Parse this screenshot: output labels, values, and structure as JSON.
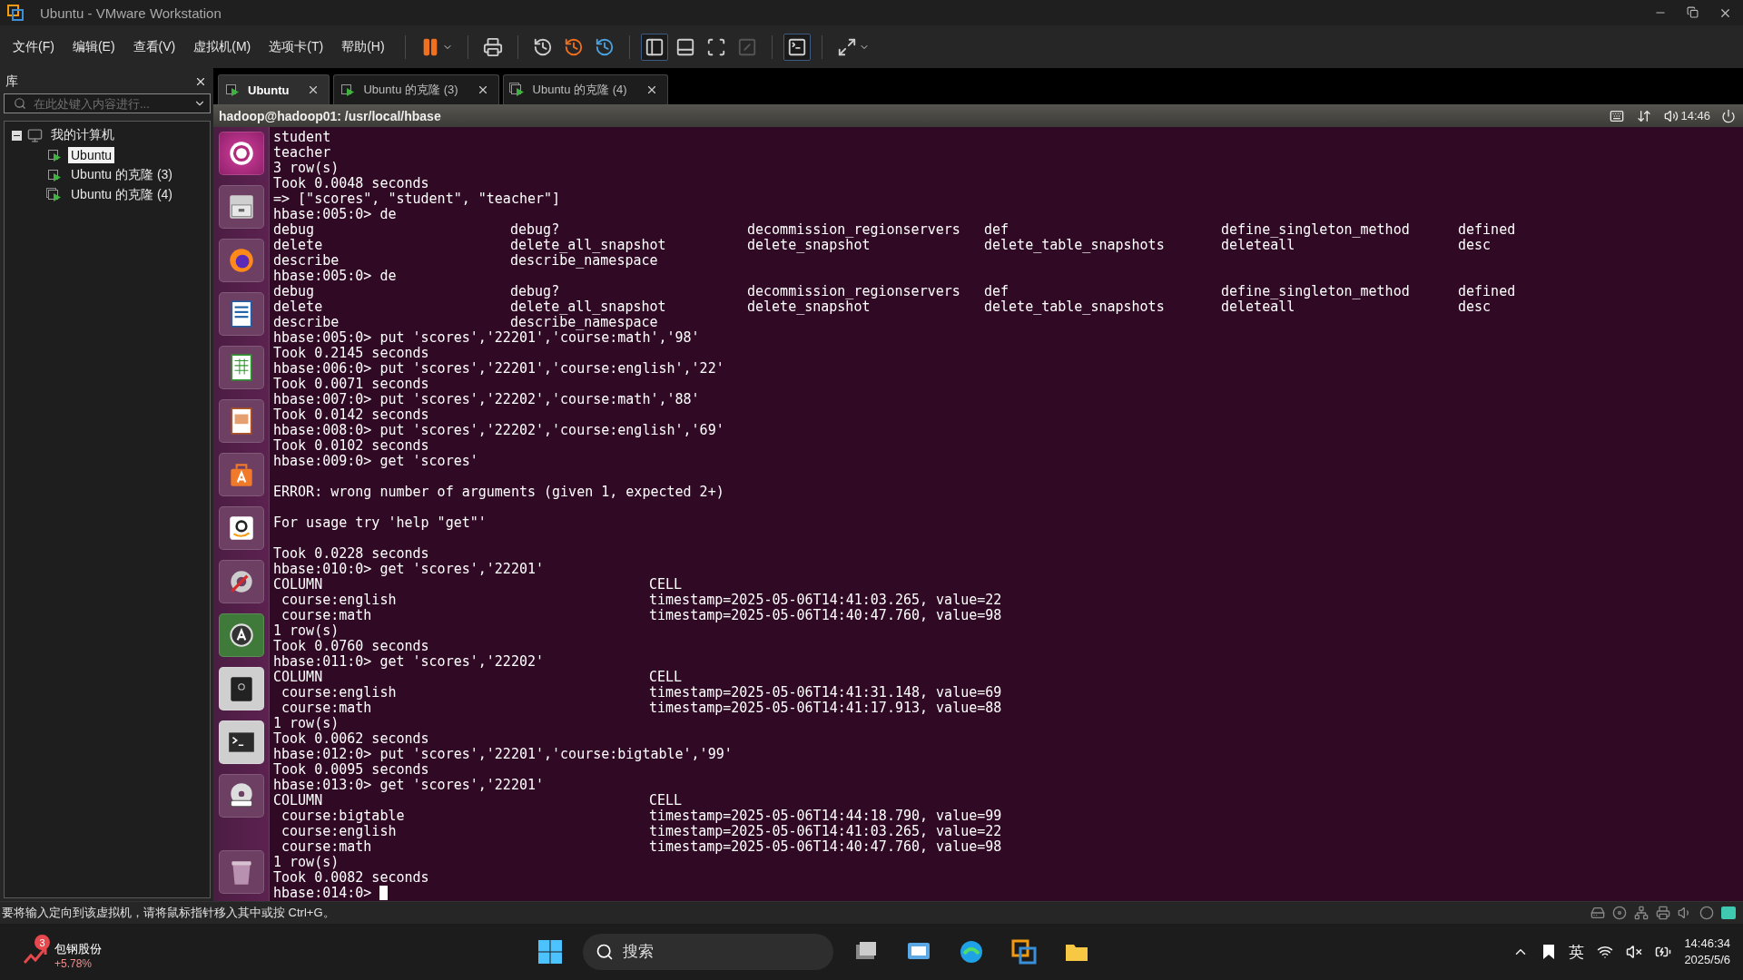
{
  "window": {
    "title": "Ubuntu - VMware Workstation"
  },
  "menu": [
    "文件(F)",
    "编辑(E)",
    "查看(V)",
    "虚拟机(M)",
    "选项卡(T)",
    "帮助(H)"
  ],
  "library": {
    "title": "库",
    "search": {
      "placeholder": "在此处键入内容进行..."
    },
    "tree": [
      {
        "label": "我的计算机",
        "expanded": true,
        "children": [
          {
            "label": "Ubuntu",
            "selected": true
          },
          {
            "label": "Ubuntu 的克隆 (3)",
            "selected": false
          },
          {
            "label": "Ubuntu 的克隆 (4)",
            "selected": false
          }
        ]
      }
    ]
  },
  "tabs": [
    {
      "label": "Ubuntu",
      "selected": true
    },
    {
      "label": "Ubuntu 的克隆 (3)",
      "selected": false
    },
    {
      "label": "Ubuntu 的克隆 (4)",
      "selected": false
    }
  ],
  "vm": {
    "top_panel": {
      "title": "hadoop@hadoop01: /usr/local/hbase",
      "time": "14:46"
    },
    "terminal": {
      "lines": [
        {
          "kind": "text",
          "text": "student"
        },
        {
          "kind": "text",
          "text": "teacher"
        },
        {
          "kind": "text",
          "text": "3 row(s)"
        },
        {
          "kind": "text",
          "text": "Took 0.0048 seconds"
        },
        {
          "kind": "text",
          "text": "=> [\"scores\", \"student\", \"teacher\"]"
        },
        {
          "kind": "text",
          "text": "hbase:005:0> de"
        },
        {
          "kind": "columns",
          "cells": [
            "debug",
            "debug?",
            "decommission_regionservers",
            "def",
            "define_singleton_method",
            "defined"
          ]
        },
        {
          "kind": "columns",
          "cells": [
            "delete",
            "delete_all_snapshot",
            "delete_snapshot",
            "delete_table_snapshots",
            "deleteall",
            "desc"
          ]
        },
        {
          "kind": "columns",
          "cells": [
            "describe",
            "describe_namespace"
          ]
        },
        {
          "kind": "text",
          "text": "hbase:005:0> de"
        },
        {
          "kind": "columns",
          "cells": [
            "debug",
            "debug?",
            "decommission_regionservers",
            "def",
            "define_singleton_method",
            "defined"
          ]
        },
        {
          "kind": "columns",
          "cells": [
            "delete",
            "delete_all_snapshot",
            "delete_snapshot",
            "delete_table_snapshots",
            "deleteall",
            "desc"
          ]
        },
        {
          "kind": "columns",
          "cells": [
            "describe",
            "describe_namespace"
          ]
        },
        {
          "kind": "text",
          "text": "hbase:005:0> put 'scores','22201','course:math','98'"
        },
        {
          "kind": "text",
          "text": "Took 0.2145 seconds"
        },
        {
          "kind": "text",
          "text": "hbase:006:0> put 'scores','22201','course:english','22'"
        },
        {
          "kind": "text",
          "text": "Took 0.0071 seconds"
        },
        {
          "kind": "text",
          "text": "hbase:007:0> put 'scores','22202','course:math','88'"
        },
        {
          "kind": "text",
          "text": "Took 0.0142 seconds"
        },
        {
          "kind": "text",
          "text": "hbase:008:0> put 'scores','22202','course:english','69'"
        },
        {
          "kind": "text",
          "text": "Took 0.0102 seconds"
        },
        {
          "kind": "text",
          "text": "hbase:009:0> get 'scores'"
        },
        {
          "kind": "blank"
        },
        {
          "kind": "text",
          "text": "ERROR: wrong number of arguments (given 1, expected 2+)"
        },
        {
          "kind": "blank"
        },
        {
          "kind": "text",
          "text": "For usage try 'help \"get\"'"
        },
        {
          "kind": "blank"
        },
        {
          "kind": "text",
          "text": "Took 0.0228 seconds"
        },
        {
          "kind": "text",
          "text": "hbase:010:0> get 'scores','22201'"
        },
        {
          "kind": "table",
          "cells": [
            "COLUMN",
            "CELL"
          ]
        },
        {
          "kind": "table",
          "cells": [
            " course:english",
            "timestamp=2025-05-06T14:41:03.265, value=22"
          ]
        },
        {
          "kind": "table",
          "cells": [
            " course:math",
            "timestamp=2025-05-06T14:40:47.760, value=98"
          ]
        },
        {
          "kind": "text",
          "text": "1 row(s)"
        },
        {
          "kind": "text",
          "text": "Took 0.0760 seconds"
        },
        {
          "kind": "text",
          "text": "hbase:011:0> get 'scores','22202'"
        },
        {
          "kind": "table",
          "cells": [
            "COLUMN",
            "CELL"
          ]
        },
        {
          "kind": "table",
          "cells": [
            " course:english",
            "timestamp=2025-05-06T14:41:31.148, value=69"
          ]
        },
        {
          "kind": "table",
          "cells": [
            " course:math",
            "timestamp=2025-05-06T14:41:17.913, value=88"
          ]
        },
        {
          "kind": "text",
          "text": "1 row(s)"
        },
        {
          "kind": "text",
          "text": "Took 0.0062 seconds"
        },
        {
          "kind": "text",
          "text": "hbase:012:0> put 'scores','22201','course:bigtable','99'"
        },
        {
          "kind": "text",
          "text": "Took 0.0095 seconds"
        },
        {
          "kind": "text",
          "text": "hbase:013:0> get 'scores','22201'"
        },
        {
          "kind": "table",
          "cells": [
            "COLUMN",
            "CELL"
          ]
        },
        {
          "kind": "table",
          "cells": [
            " course:bigtable",
            "timestamp=2025-05-06T14:44:18.790, value=99"
          ]
        },
        {
          "kind": "table",
          "cells": [
            " course:english",
            "timestamp=2025-05-06T14:41:03.265, value=22"
          ]
        },
        {
          "kind": "table",
          "cells": [
            " course:math",
            "timestamp=2025-05-06T14:40:47.760, value=98"
          ]
        },
        {
          "kind": "text",
          "text": "1 row(s)"
        },
        {
          "kind": "text",
          "text": "Took 0.0082 seconds"
        },
        {
          "kind": "prompt",
          "text": "hbase:014:0>",
          "cursor": true
        }
      ]
    }
  },
  "status_bar": {
    "message": "要将输入定向到该虚拟机，请将鼠标指针移入其中或按 Ctrl+G。"
  },
  "taskbar": {
    "stock": {
      "badge": "3",
      "name": "包钢股份",
      "change": "+5.78%"
    },
    "search": {
      "placeholder": "搜索"
    },
    "ime": "英",
    "clock": {
      "time": "14:46:34",
      "date": "2025/5/6"
    }
  }
}
